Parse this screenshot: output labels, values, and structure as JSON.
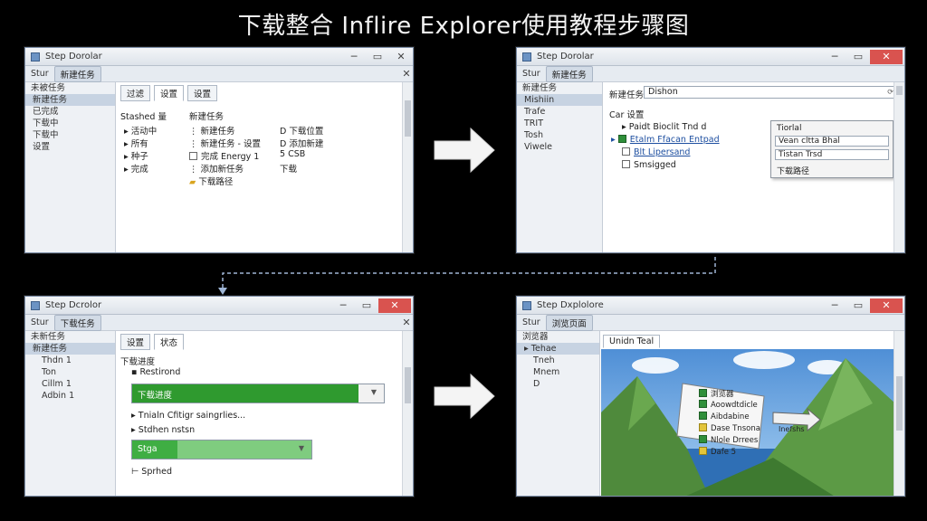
{
  "page_title": "下载整合 Inflire Explorer使用教程步骤图",
  "colors": {
    "accent_green": "#2f9a2f",
    "close_red": "#d9534f",
    "select_blue": "#c7d3e2"
  },
  "icons": [
    "app-icon",
    "minimize-icon",
    "maximize-icon",
    "close-icon",
    "arrow-right-icon",
    "checkbox-icon",
    "folder-icon"
  ],
  "win1": {
    "title": "Step Dorolar",
    "addr_prefix": "Stur",
    "addr_crumb": "新建任务",
    "sidebar": [
      "未被任务",
      "新建任务",
      "已完成",
      "下载中",
      "下载中",
      "设置"
    ],
    "tabs": [
      "过滤",
      "设置",
      "设置"
    ],
    "tree_header": "Stashed 量",
    "tree_header2": "新建任务",
    "left_items": [
      "活动中",
      "所有",
      "种子",
      "完成"
    ],
    "mid_items": [
      "新建任务",
      "新建任务 - 设置",
      "完成 Energy 1",
      "添加新任务",
      "下载路径"
    ],
    "right_items": [
      "D 下载位置",
      "D 添加新建",
      "5 CSB",
      "下载"
    ]
  },
  "win2": {
    "title": "Step Dorolar",
    "addr_prefix": "Stur",
    "addr_crumb": "新建任务",
    "sidebar": [
      "新建任务",
      "Mishiin",
      "Trafe",
      "TRIT",
      "Tosh",
      "Viwele"
    ],
    "search_label": "新建任务",
    "search_value": "Dishon",
    "section_label": "Car 设置",
    "tree_items": [
      "Paidt Bioclit Tnd d",
      "Etalm Ffacan Entpad",
      "Blt Lipersand",
      "Smsigged"
    ],
    "popup_items": [
      "Tiorlal",
      "Vean cltta Bhal",
      "Tistan Trsd",
      "下载路径"
    ]
  },
  "win3": {
    "title": "Step Dcrolor",
    "addr_prefix": "Stur",
    "addr_crumb": "下载任务",
    "sidebar": [
      "未新任务",
      "新建任务",
      "Thdn 1",
      "Ton",
      "Cillm 1",
      "Adbin 1"
    ],
    "tabs": [
      "设置",
      "状态"
    ],
    "head_label": "下载进度",
    "sub_label": "Restirond",
    "bar1_label": "下载进度",
    "options_label": "Tnialn Cfitigr saingrlies...",
    "storage_label": "Stdhen nstsn",
    "bar2_label": "Stga",
    "end_label": "Sprhed",
    "progress1": 0.9,
    "progress2": 0.25
  },
  "win4": {
    "title": "Step Dxplolore",
    "addr_prefix": "Stur",
    "addr_crumb": "浏览页面",
    "sidebar": [
      "浏览器",
      "Tehae",
      "Tneh",
      "Mnem",
      "D"
    ],
    "tab_label": "Unidn Teal",
    "card_items": [
      "浏览器",
      "Aoowdtdicle",
      "Aibdabine",
      "Dase Tnsona",
      "Nlole Drrees",
      "Dafe 5"
    ],
    "callout": "Inefshs"
  }
}
